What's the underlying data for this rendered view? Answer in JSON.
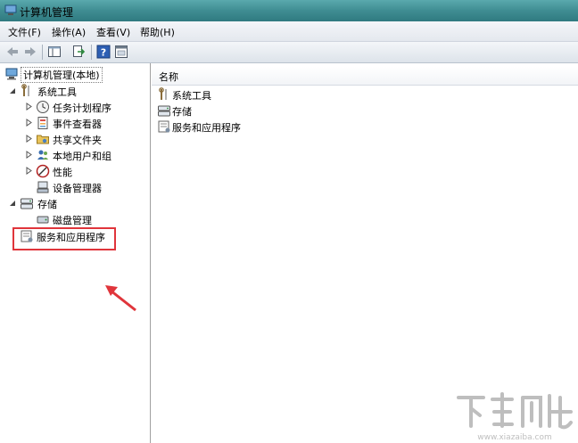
{
  "window": {
    "title": "计算机管理"
  },
  "menu": [
    "文件(F)",
    "操作(A)",
    "查看(V)",
    "帮助(H)"
  ],
  "toolbar": [
    "back-icon",
    "forward-icon",
    "show-hide-tree-icon",
    "export-list-icon",
    "help-icon",
    "properties-icon"
  ],
  "tree": {
    "root": "计算机管理(本地)",
    "system_tools": "系统工具",
    "task_scheduler": "任务计划程序",
    "event_viewer": "事件查看器",
    "shared_folders": "共享文件夹",
    "local_users": "本地用户和组",
    "performance": "性能",
    "device_manager": "设备管理器",
    "storage": "存储",
    "disk_management": "磁盘管理",
    "services_apps": "服务和应用程序"
  },
  "list": {
    "column_name": "名称",
    "items": [
      "系统工具",
      "存储",
      "服务和应用程序"
    ]
  },
  "colors": {
    "titlebar": "#3f8d92",
    "highlight": "#e0353b"
  },
  "watermark": {
    "url_text": "www.xiazaiba.com"
  }
}
